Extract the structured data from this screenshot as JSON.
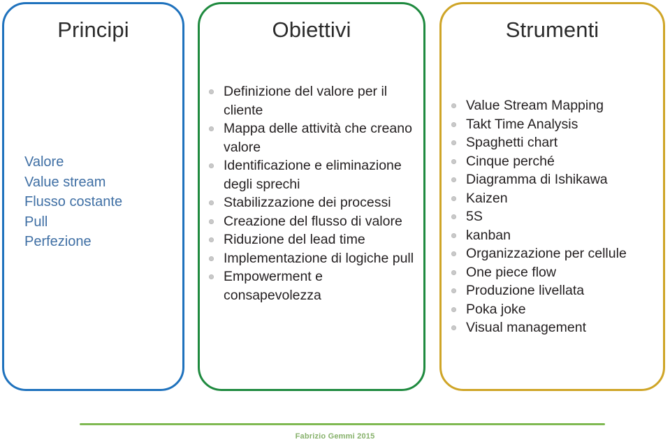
{
  "slide": {
    "background": "#ffffff",
    "panels": [
      {
        "key": "principi",
        "title": "Principi",
        "accent": "#1f72bd",
        "text_color": "#3f6fa4",
        "bulleted": false,
        "items": [
          "Valore",
          "Value stream",
          "Flusso costante",
          "Pull",
          "Perfezione"
        ]
      },
      {
        "key": "obiettivi",
        "title": "Obiettivi",
        "accent": "#1f8a3f",
        "text_color": "#231f20",
        "bulleted": true,
        "bullet_icon": "small-circle-bullet",
        "items": [
          "Definizione del valore per il cliente",
          "Mappa delle attività che creano valore",
          "Identificazione e eliminazione degli sprechi",
          "Stabilizzazione dei processi",
          "Creazione del flusso di valore",
          "Riduzione del lead time",
          "Implementazione di logiche pull",
          "Empowerment e consapevolezza"
        ]
      },
      {
        "key": "strumenti",
        "title": "Strumenti",
        "accent": "#cfa527",
        "text_color": "#231f20",
        "bulleted": true,
        "bullet_icon": "small-circle-bullet",
        "items": [
          "Value Stream Mapping",
          "Takt Time Analysis",
          "Spaghetti chart",
          "Cinque perché",
          "Diagramma di Ishikawa",
          "Kaizen",
          "5S",
          "kanban",
          "Organizzazione per cellule",
          "One piece flow",
          "Produzione livellata",
          "Poka joke",
          "Visual management"
        ]
      }
    ]
  },
  "footer": {
    "credit": "Fabrizio Gemmi 2015",
    "rule_color": "#7fb952",
    "text_color": "#86b16a"
  }
}
